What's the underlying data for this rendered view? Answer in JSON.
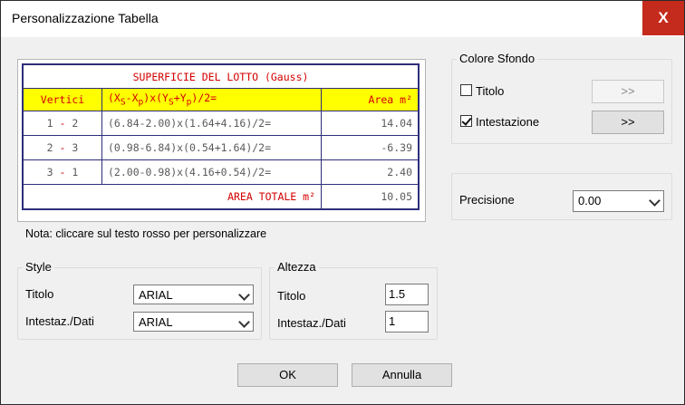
{
  "window": {
    "title": "Personalizzazione Tabella",
    "close_glyph": "X"
  },
  "table": {
    "title": "SUPERFICIE DEL LOTTO (Gauss)",
    "headers": {
      "vertici": "Vertici",
      "formula_parts": [
        "(X",
        "S",
        "-X",
        "p",
        ")x(Y",
        "S",
        "+Y",
        "p",
        ")/2="
      ],
      "area": "Area m²"
    },
    "rows": [
      {
        "a": "1",
        "b": "2",
        "formula": "(6.84-2.00)x(1.64+4.16)/2=",
        "area": "14.04"
      },
      {
        "a": "2",
        "b": "3",
        "formula": "(0.98-6.84)x(0.54+1.64)/2=",
        "area": "-6.39"
      },
      {
        "a": "3",
        "b": "1",
        "formula": "(2.00-0.98)x(4.16+0.54)/2=",
        "area": "2.40"
      }
    ],
    "total_label": "AREA TOTALE m²",
    "total_value": "10.05",
    "dash": "-"
  },
  "note": "Nota: cliccare sul testo rosso per personalizzare",
  "colore_sfondo": {
    "label": "Colore Sfondo",
    "titolo": {
      "label": "Titolo",
      "checked": false,
      "button": ">>"
    },
    "intestazione": {
      "label": "Intestazione",
      "checked": true,
      "button": ">>"
    }
  },
  "precisione": {
    "label": "Precisione",
    "value": "0.00"
  },
  "style": {
    "label": "Style",
    "titolo_label": "Titolo",
    "titolo_value": "ARIAL",
    "intestaz_label": "Intestaz./Dati",
    "intestaz_value": "ARIAL"
  },
  "altezza": {
    "label": "Altezza",
    "titolo_label": "Titolo",
    "titolo_value": "1.5",
    "intestaz_label": "Intestaz./Dati",
    "intestaz_value": "1"
  },
  "buttons": {
    "ok": "OK",
    "annulla": "Annulla"
  },
  "colors": {
    "accent_red": "#d40000",
    "header_yellow": "#ffff00",
    "border_navy": "#2e2e7a",
    "close_red": "#c42b1c"
  }
}
